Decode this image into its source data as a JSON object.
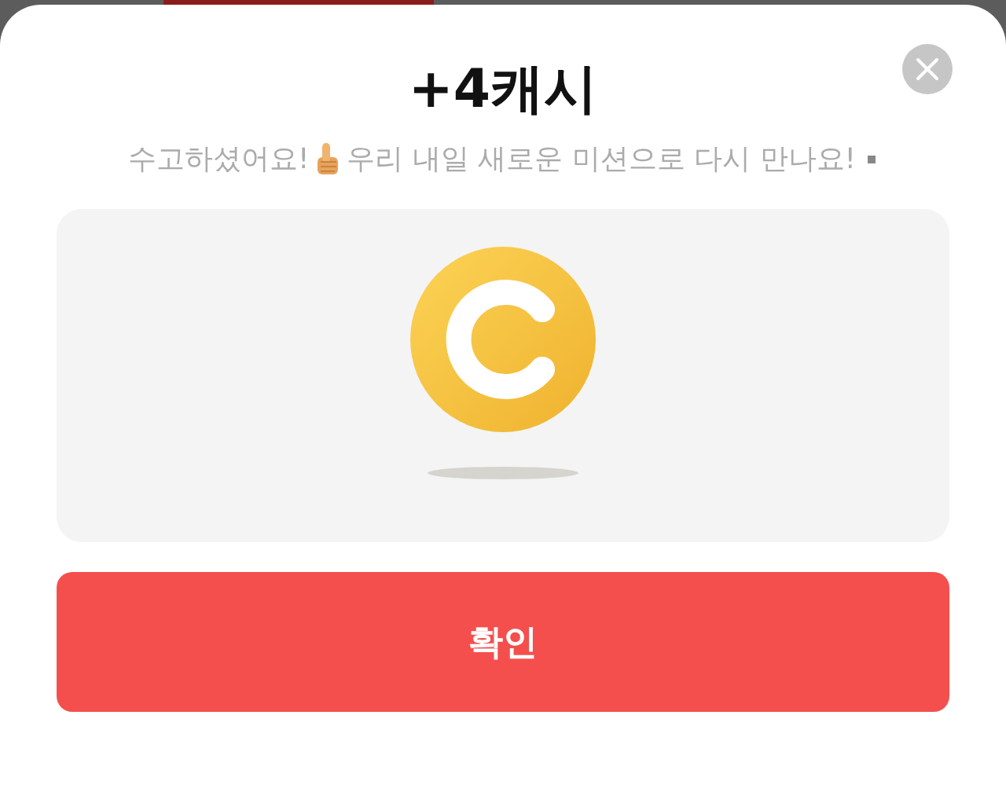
{
  "reward": {
    "title": "+4캐시",
    "message_start": "수고하셨어요!",
    "message_end": "우리 내일 새로운 미션으로 다시 만나요!"
  },
  "confirm_button": {
    "label": "확인"
  }
}
